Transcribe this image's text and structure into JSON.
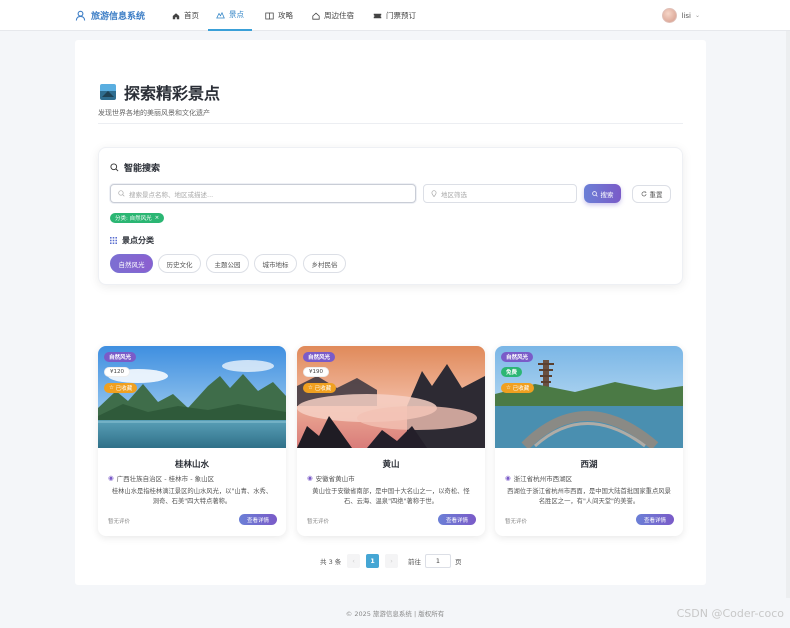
{
  "nav": {
    "brand": "旅游信息系统",
    "items": [
      {
        "label": "首页",
        "icon": "home-icon"
      },
      {
        "label": "景点",
        "icon": "scenic-icon",
        "active": true
      },
      {
        "label": "攻略",
        "icon": "book-icon"
      },
      {
        "label": "周边住宿",
        "icon": "house-icon"
      },
      {
        "label": "门票预订",
        "icon": "ticket-icon"
      }
    ],
    "user": "lisi"
  },
  "page": {
    "title": "探索精彩景点",
    "subtitle": "发现世界各地的美丽风景和文化遗产"
  },
  "search": {
    "title": "智能搜索",
    "keyword_placeholder": "搜索景点名称、地区或描述...",
    "region_placeholder": "地区筛选",
    "search_label": "搜索",
    "reset_label": "重置",
    "active_filter": "分类: 自然风光",
    "category_title": "景点分类",
    "categories": [
      "自然风光",
      "历史文化",
      "主题公园",
      "城市地标",
      "乡村民俗"
    ]
  },
  "cards": [
    {
      "category": "自然风光",
      "price": "¥120",
      "fav": "已收藏",
      "name": "桂林山水",
      "location": "广西壮族自治区 - 桂林市 - 象山区",
      "desc": "桂林山水是指桂林漓江景区的山水风光，以\"山青、水秀、洞奇、石美\"四大特点著称。",
      "rating": "暂无评价",
      "detail": "查看详情"
    },
    {
      "category": "自然风光",
      "price": "¥190",
      "fav": "已收藏",
      "name": "黄山",
      "location": "安徽省黄山市",
      "desc": "黄山位于安徽省南部，是中国十大名山之一，以奇松、怪石、云海、温泉\"四绝\"著称于世。",
      "rating": "暂无评价",
      "detail": "查看详情"
    },
    {
      "category": "自然风光",
      "price": "免费",
      "fav": "已收藏",
      "name": "西湖",
      "location": "浙江省杭州市西湖区",
      "desc": "西湖位于浙江省杭州市西面，是中国大陆首批国家重点风景名胜区之一，有\"人间天堂\"的美誉。",
      "rating": "暂无评价",
      "detail": "查看详情"
    }
  ],
  "pagination": {
    "total": "共 3 条",
    "current": "1",
    "goto_label": "前往",
    "goto_value": "1",
    "page_unit": "页"
  },
  "footer": "© 2025 旅游信息系统 | 版权所有",
  "watermark": "CSDN @Coder-coco"
}
